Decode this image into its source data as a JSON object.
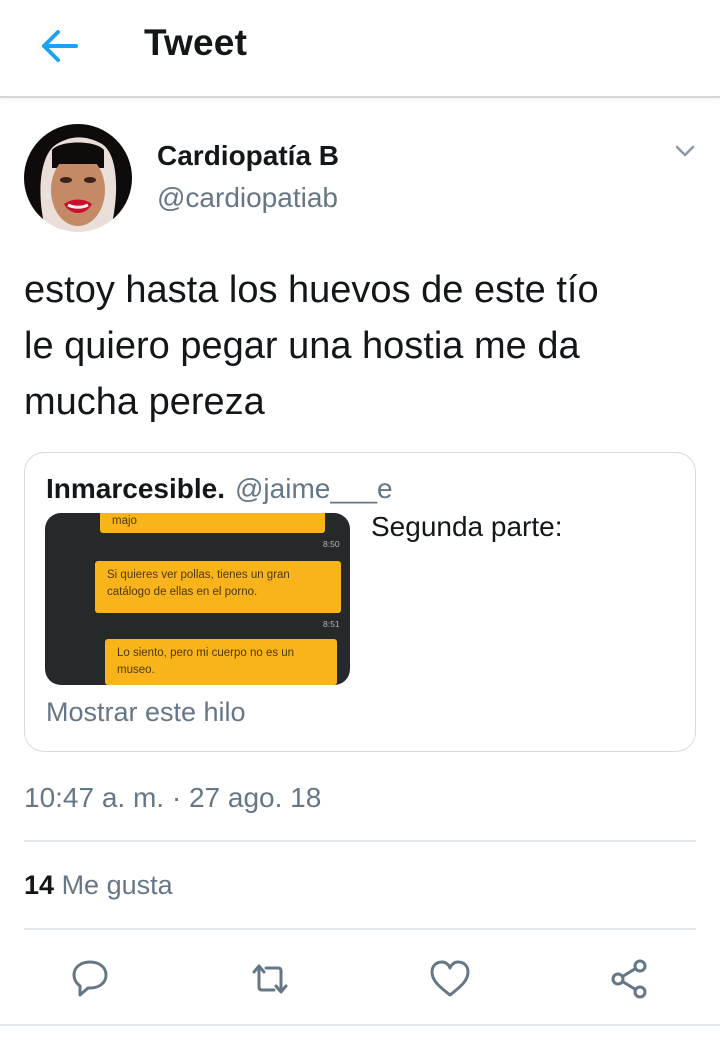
{
  "header": {
    "title": "Tweet"
  },
  "tweet": {
    "author": {
      "name": "Cardiopatía B",
      "handle": "@cardiopatiab"
    },
    "text_lines": [
      "estoy hasta los huevos de este tío",
      "le quiero pegar una hostia me da",
      "mucha pereza"
    ],
    "timestamp": "10:47 a. m. · 27 ago. 18",
    "likes": {
      "count": "14",
      "label": "Me gusta"
    }
  },
  "quote": {
    "author_name": "Inmarcesible.",
    "author_handle": "@jaime___e",
    "text": "Segunda parte:",
    "show_thread": "Mostrar este hilo",
    "media": {
      "messages": [
        {
          "text": "majo",
          "time": "8:50"
        },
        {
          "text": "Si quieres ver pollas, tienes un gran catálogo de ellas en el porno.",
          "line1": "Si quieres ver pollas, tienes un gran",
          "line2": "catálogo de ellas en el porno.",
          "time": "8:51"
        },
        {
          "text": "Lo siento, pero mi cuerpo no es un museo.",
          "line1": "Lo siento, pero mi cuerpo no es un",
          "line2": "museo."
        }
      ]
    }
  },
  "colors": {
    "accent": "#1da1f2",
    "secondary_text": "#657786",
    "chat_bubble": "#f9b31b",
    "chat_background": "#26292a"
  },
  "icons": [
    "back-arrow-icon",
    "chevron-down-icon",
    "reply-icon",
    "retweet-icon",
    "like-icon",
    "share-icon"
  ]
}
